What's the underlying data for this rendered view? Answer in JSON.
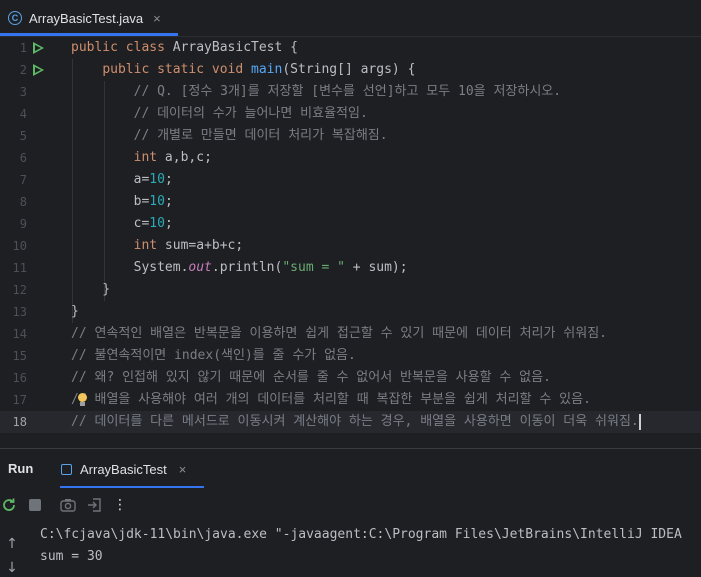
{
  "editor_tab": {
    "class_icon_letter": "C",
    "title": "ArrayBasicTest.java",
    "close": "×"
  },
  "code_lines": {
    "1": {
      "n": "1",
      "pre": "",
      "kw1": "public class",
      "rest": " ArrayBasicTest {"
    },
    "2": {
      "n": "2",
      "pre": "    ",
      "kw": "public static void",
      "sp": " ",
      "method": "main",
      "rest": "(String[] args) {"
    },
    "3": {
      "n": "3",
      "text": "        // Q. [정수 3개]를 저장할 [변수를 선언]하고 모두 10을 저장하시오."
    },
    "4": {
      "n": "4",
      "text": "        // 데이터의 수가 늘어나면 비효율적임."
    },
    "5": {
      "n": "5",
      "text": "        // 개별로 만들면 데이터 처리가 복잡해짐."
    },
    "6": {
      "n": "6",
      "pre": "        ",
      "kw": "int",
      "rest": " a,b,c;"
    },
    "7": {
      "n": "7",
      "pre": "        a=",
      "num": "10",
      "rest": ";"
    },
    "8": {
      "n": "8",
      "pre": "        b=",
      "num": "10",
      "rest": ";"
    },
    "9": {
      "n": "9",
      "pre": "        c=",
      "num": "10",
      "rest": ";"
    },
    "10": {
      "n": "10",
      "pre": "        ",
      "kw": "int",
      "rest": " sum=a+b+c;"
    },
    "11": {
      "n": "11",
      "pre": "        System.",
      "field": "out",
      "mid": ".println(",
      "str": "\"sum = \"",
      "rest": " + sum);"
    },
    "12": {
      "n": "12",
      "text": "    }"
    },
    "13": {
      "n": "13",
      "text": "}"
    },
    "14": {
      "n": "14",
      "text": "// 연속적인 배열은 반복문을 이용하면 쉽게 접근할 수 있기 때문에 데이터 처리가 쉬워짐."
    },
    "15": {
      "n": "15",
      "text": "// 불연속적이면 index(색인)를 줄 수가 없음."
    },
    "16": {
      "n": "16",
      "text": "// 왜? 인접해 있지 않기 때문에 순서를 줄 수 없어서 반복문을 사용할 수 없음."
    },
    "17": {
      "n": "17",
      "text": "// 배열을 사용해야 여러 개의 데이터를 처리할 때 복잡한 부분을 쉽게 처리할 수 있음."
    },
    "18": {
      "n": "18",
      "text": "// 데이터를 다른 메서드로 이동시켜 계산해야 하는 경우, 배열을 사용하면 이동이 더욱 쉬워짐."
    }
  },
  "run_panel": {
    "title": "Run",
    "tab_title": "ArrayBasicTest",
    "tab_close": "×",
    "console_lines": [
      "C:\\fcjava\\jdk-11\\bin\\java.exe \"-javaagent:C:\\Program Files\\JetBrains\\IntelliJ IDEA",
      "sum = 30"
    ]
  },
  "icons": {
    "rerun": "rerun-icon",
    "stop": "stop-icon",
    "camera": "screenshot-icon",
    "exit": "exit-icon",
    "more": "more-icon",
    "up": "up-arrow-icon",
    "down": "down-arrow-icon",
    "bulb": "lightbulb-icon",
    "run_gutter": "run-gutter-icon"
  },
  "colors": {
    "background": "#1e1f22",
    "keyword": "#cf8e6d",
    "method": "#56a8f5",
    "number": "#2aacb8",
    "comment": "#7a7e85",
    "string": "#6aab73",
    "static_field": "#c77dbb",
    "run_green": "#5fb865",
    "accent": "#3574f0"
  }
}
